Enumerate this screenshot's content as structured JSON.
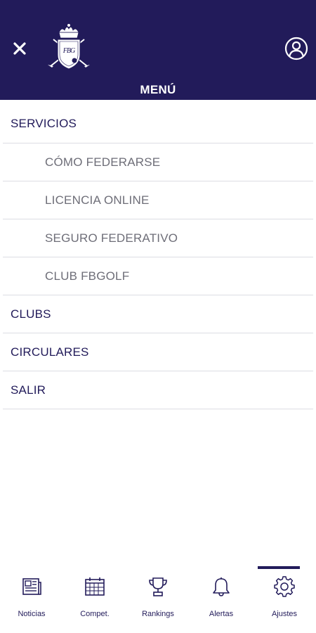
{
  "header": {
    "menu_title": "MENÚ",
    "logo_letters": "FBG",
    "background_color": "#221b5a"
  },
  "menu": {
    "items": [
      {
        "label": "SERVICIOS",
        "level": "primary"
      },
      {
        "label": "CÓMO FEDERARSE",
        "level": "sub"
      },
      {
        "label": "LICENCIA ONLINE",
        "level": "sub"
      },
      {
        "label": "SEGURO FEDERATIVO",
        "level": "sub"
      },
      {
        "label": "CLUB FBGOLF",
        "level": "sub"
      },
      {
        "label": "CLUBS",
        "level": "primary"
      },
      {
        "label": "CIRCULARES",
        "level": "primary"
      },
      {
        "label": "SALIR",
        "level": "primary"
      }
    ]
  },
  "tabbar": {
    "active_tab": "Ajustes",
    "tabs": [
      {
        "label": "Noticias",
        "icon": "newspaper-icon"
      },
      {
        "label": "Compet.",
        "icon": "calendar-icon"
      },
      {
        "label": "Rankings",
        "icon": "trophy-icon"
      },
      {
        "label": "Alertas",
        "icon": "bell-icon"
      },
      {
        "label": "Ajustes",
        "icon": "gear-icon"
      }
    ]
  },
  "colors": {
    "brand": "#221b5a",
    "sub_item_text": "#6e6e78",
    "divider": "#dcdde3"
  }
}
